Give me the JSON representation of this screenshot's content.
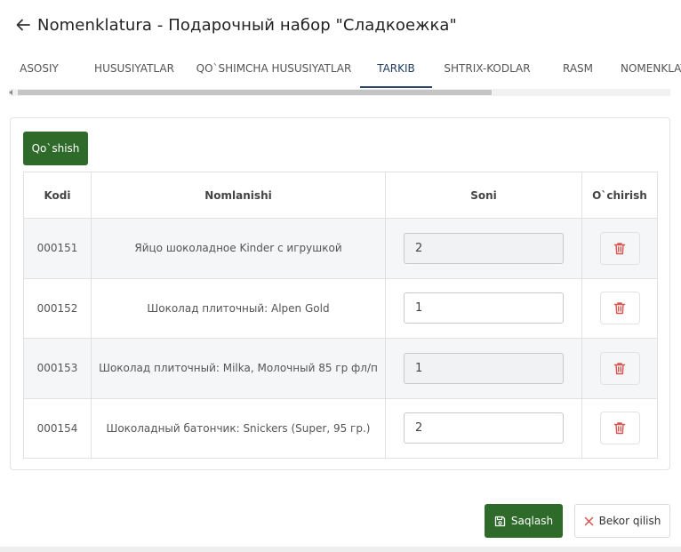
{
  "header": {
    "title": "Nomenklatura - Подарочный набор \"Сладкоежка\""
  },
  "tabs": [
    {
      "label": "ASOSIY"
    },
    {
      "label": "HUSUSIYATLAR"
    },
    {
      "label": "QO`SHIMCHA HUSUSIYATLAR"
    },
    {
      "label": "TARKIB",
      "active": true
    },
    {
      "label": "SHTRIX-KODLAR"
    },
    {
      "label": "RASM"
    },
    {
      "label": "NOMENKLATURA"
    }
  ],
  "composition": {
    "add_label": "Qo`shish",
    "columns": {
      "code": "Kodi",
      "name": "Nomlanishi",
      "qty": "Soni",
      "delete": "O`chirish"
    },
    "rows": [
      {
        "code": "000151",
        "name": "Яйцо шоколадное Kinder с игрушкой",
        "qty": "2"
      },
      {
        "code": "000152",
        "name": "Шоколад плиточный: Alpen Gold",
        "qty": "1"
      },
      {
        "code": "000153",
        "name": "Шоколад плиточный: Milka, Молочный 85 гр фл/п",
        "qty": "1"
      },
      {
        "code": "000154",
        "name": "Шоколадный батончик: Snickers (Super, 95 гр.)",
        "qty": "2"
      }
    ]
  },
  "footer": {
    "save_label": "Saqlash",
    "cancel_label": "Bekor qilish"
  },
  "colors": {
    "primary_green": "#2e6b2a",
    "active_tab": "#2a4468",
    "delete_red": "#d9534f"
  }
}
